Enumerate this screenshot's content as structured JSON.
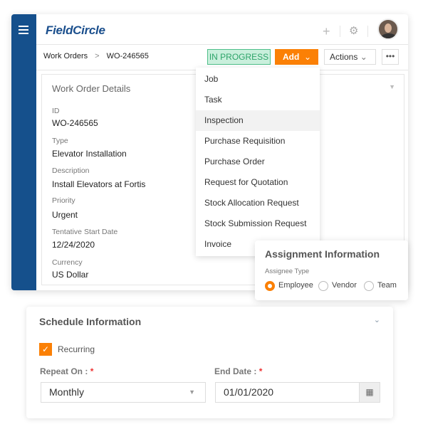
{
  "app": {
    "logo": "FieldCircle",
    "accent": "#fb8005",
    "brand": "#15508c"
  },
  "header": {
    "plus": "+",
    "gear": "⚙"
  },
  "breadcrumb": {
    "parent": "Work Orders",
    "sep": ">",
    "current": "WO-246565"
  },
  "toolbar": {
    "status": "IN PROGRESS",
    "add": "Add",
    "actions": "Actions",
    "more": "•••",
    "chev": "⌄"
  },
  "details": {
    "title": "Work Order Details",
    "fields": [
      {
        "label": "ID",
        "value": "WO-246565"
      },
      {
        "label": "Type",
        "value": "Elevator Installation"
      },
      {
        "label": "Description",
        "value": "Install Elevators at Fortis"
      },
      {
        "label": "Priority",
        "value": "Urgent"
      },
      {
        "label": "Tentative Start Date",
        "value": "12/24/2020"
      },
      {
        "label": "Currency",
        "value": "US Dollar"
      }
    ]
  },
  "add_menu": {
    "highlighted": "Inspection",
    "items": [
      "Job",
      "Task",
      "Inspection",
      "Purchase Requisition",
      "Purchase Order",
      "Request for Quotation",
      "Stock Allocation Request",
      "Stock Submission Request",
      "Invoice"
    ]
  },
  "assignment": {
    "title": "Assignment Information",
    "label": "Assignee Type",
    "options": [
      "Employee",
      "Vendor",
      "Team"
    ],
    "selected": "Employee"
  },
  "schedule": {
    "title": "Schedule Information",
    "recurring_label": "Recurring",
    "recurring": true,
    "repeat_label": "Repeat On :",
    "repeat_value": "Monthly",
    "end_label": "End Date :",
    "end_value": "01/01/2020",
    "required": "*"
  }
}
